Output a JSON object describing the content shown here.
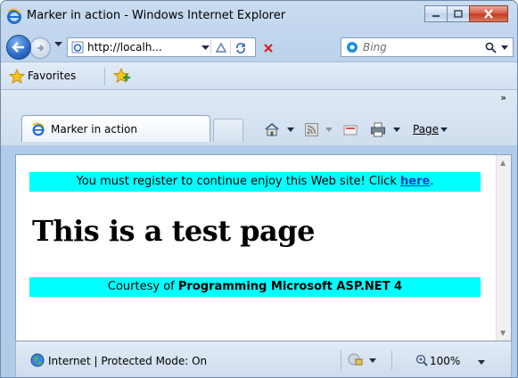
{
  "window": {
    "title": "Marker in action - Windows Internet Explorer"
  },
  "address_bar": {
    "url": "http://localh..."
  },
  "search": {
    "placeholder": "Bing"
  },
  "favorites_bar": {
    "favorites_label": "Favorites"
  },
  "tabs": [
    {
      "label": "Marker in action"
    }
  ],
  "command_bar": {
    "page_label": "Page"
  },
  "page": {
    "register_notice_prefix": "You must register to continue enjoy this Web site! Click ",
    "register_link": "here",
    "register_notice_suffix": ".",
    "heading": "This is a test page",
    "courtesy_prefix": "Courtesy of ",
    "courtesy_book": "Programming Microsoft ASP.NET 4"
  },
  "status_bar": {
    "zone_text": "Internet | Protected Mode: On",
    "zoom": "100%"
  },
  "colors": {
    "banner_background": "#00ffff",
    "link": "#0044cc",
    "close_button": "#c3361e"
  }
}
